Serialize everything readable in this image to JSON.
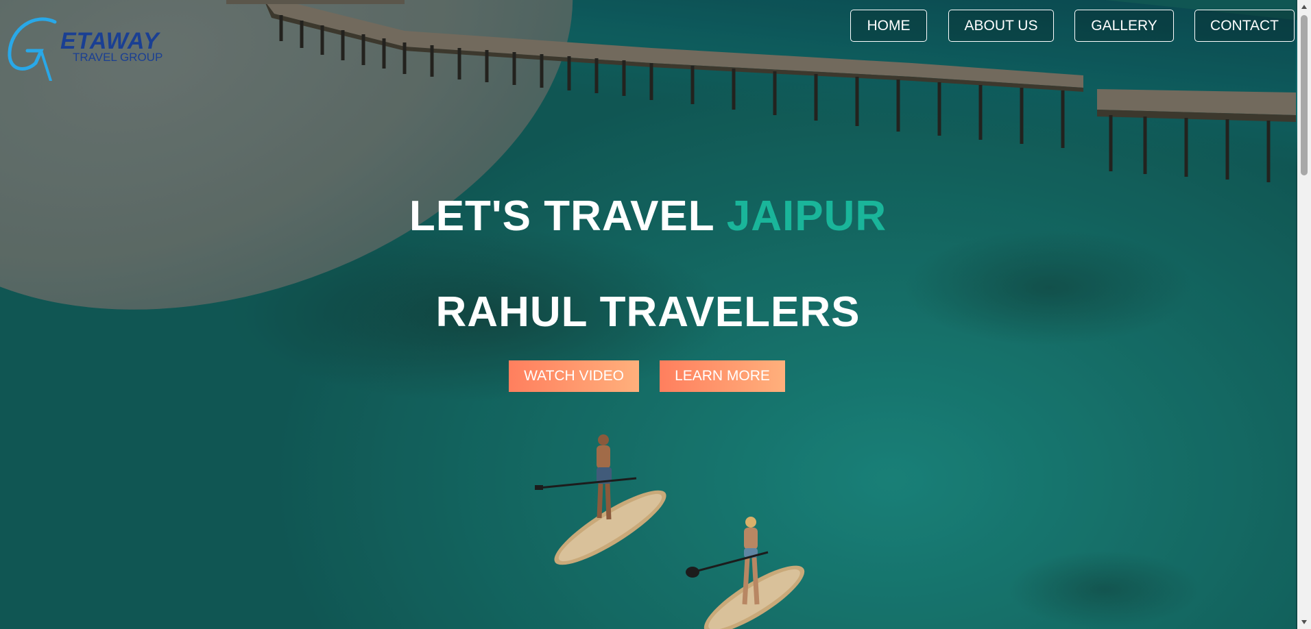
{
  "brand": {
    "logo_letter": "G",
    "logo_word": "ETAWAY",
    "logo_tagline": "TRAVEL GROUP",
    "logo_color": "#1a3f93",
    "logo_accent": "#29a8e8"
  },
  "nav": {
    "items": [
      {
        "label": "HOME"
      },
      {
        "label": "ABOUT US"
      },
      {
        "label": "GALLERY"
      },
      {
        "label": "CONTACT"
      }
    ]
  },
  "hero": {
    "title_prefix": "LET'S TRAVEL ",
    "title_accent": "JAIPUR",
    "subtitle": "RAHUL TRAVELERS",
    "accent_color": "#1ab59a",
    "buttons": {
      "watch_label": "WATCH VIDEO",
      "learn_label": "LEARN MORE"
    },
    "button_gradient": [
      "#ff7f5e",
      "#ffb07c"
    ]
  },
  "scrollbar": {
    "up_icon": "chevron-up-icon",
    "down_icon": "chevron-down-icon"
  }
}
